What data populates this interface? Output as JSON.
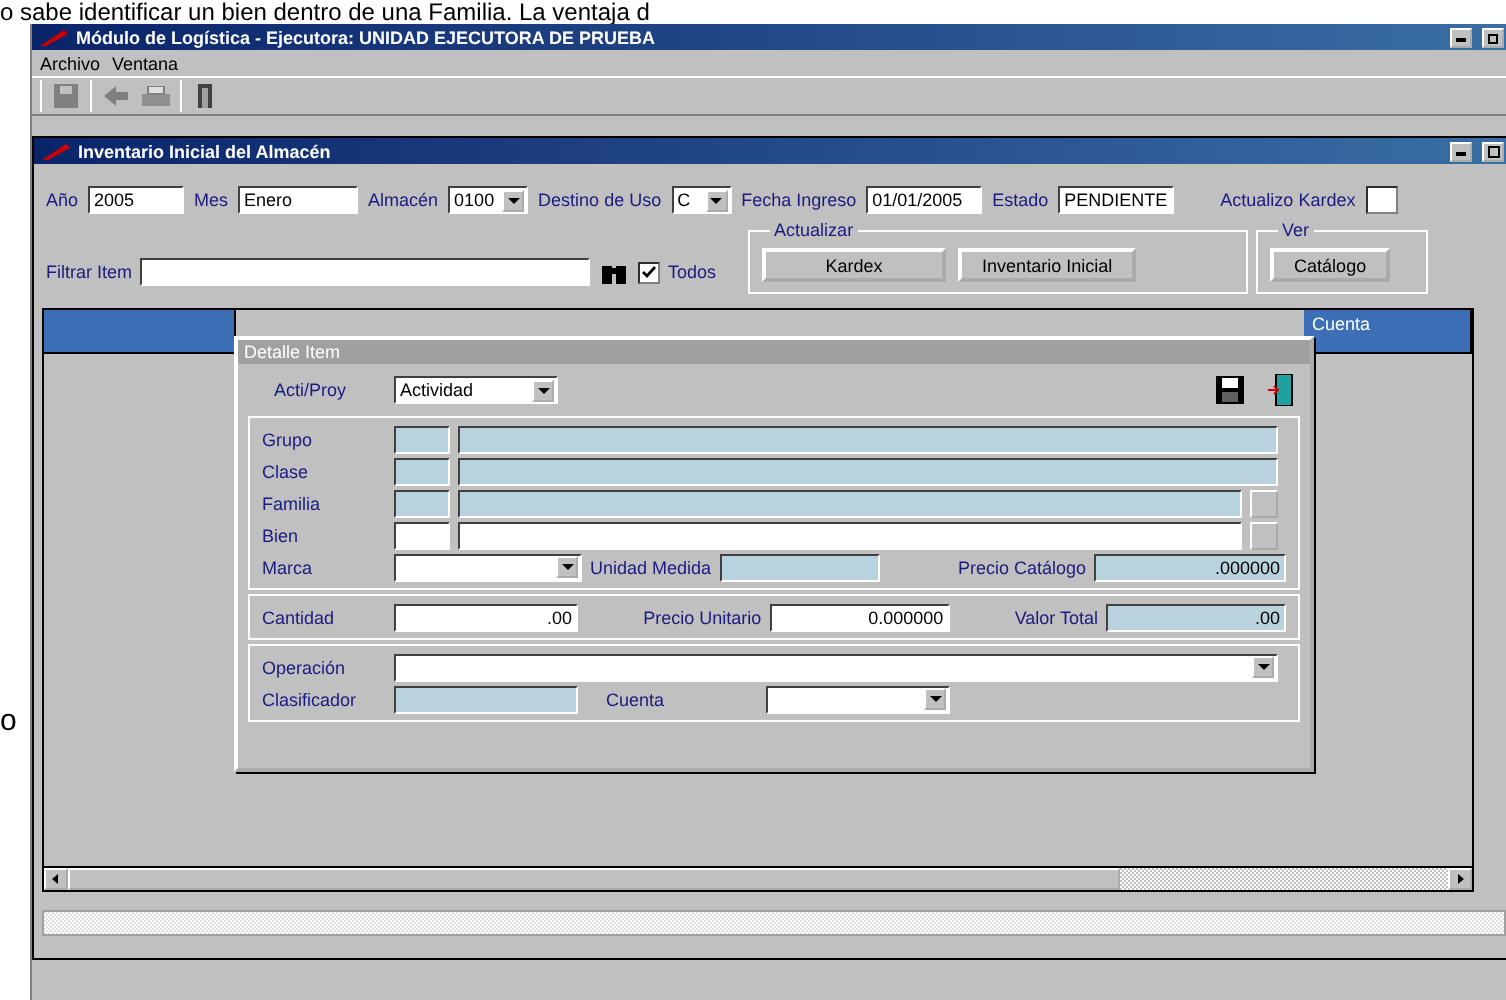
{
  "document_text": {
    "top_line": "o sabe identificar un bien dentro de una Familia.  La ventaja d",
    "left_fragment": "o"
  },
  "app_window": {
    "title": "Módulo de Logística - Ejecutora: UNIDAD EJECUTORA DE PRUEBA",
    "menu": [
      "Archivo",
      "Ventana"
    ]
  },
  "child_window": {
    "title": "Inventario Inicial del Almacén",
    "header_fields": [
      {
        "label": "Año",
        "value": "2005",
        "kind": "text"
      },
      {
        "label": "Mes",
        "value": "Enero",
        "kind": "text"
      },
      {
        "label": "Almacén",
        "value": "0100",
        "kind": "combo"
      },
      {
        "label": "Destino de Uso",
        "value": "C",
        "kind": "combo"
      },
      {
        "label": "Fecha Ingreso",
        "value": "01/01/2005",
        "kind": "text"
      },
      {
        "label": "Estado",
        "value": "PENDIENTE",
        "kind": "text"
      }
    ],
    "kardex_checkbox": {
      "label": "Actualizo Kardex",
      "checked": false
    },
    "filter": {
      "label": "Filtrar Item",
      "all_checkbox": {
        "label": "Todos",
        "checked": true
      }
    },
    "groups": [
      {
        "title": "Actualizar",
        "buttons": [
          "Kardex",
          "Inventario Inicial"
        ]
      },
      {
        "title": "Ver",
        "buttons": [
          "Catálogo"
        ]
      }
    ],
    "grid": {
      "columns": [
        "Cuenta"
      ]
    }
  },
  "dialog": {
    "title": "Detalle Item",
    "acti_proy": {
      "label": "Acti/Proy",
      "value": "Actividad"
    },
    "classification_rows": [
      {
        "label": "Grupo",
        "readonly": true,
        "lookup_button": false
      },
      {
        "label": "Clase",
        "readonly": true,
        "lookup_button": false
      },
      {
        "label": "Familia",
        "readonly": true,
        "lookup_button": true
      },
      {
        "label": "Bien",
        "readonly": false,
        "lookup_button": true
      }
    ],
    "marca": {
      "label": "Marca"
    },
    "unidad_medida": {
      "label": "Unidad Medida"
    },
    "precio_catalogo": {
      "label": "Precio Catálogo",
      "value": ".000000"
    },
    "amounts": [
      {
        "label": "Cantidad",
        "value": ".00",
        "readonly": false
      },
      {
        "label": "Precio Unitario",
        "value": "0.000000",
        "readonly": false
      },
      {
        "label": "Valor Total",
        "value": ".00",
        "readonly": true
      }
    ],
    "operacion": {
      "label": "Operación"
    },
    "clasificador": {
      "label": "Clasificador"
    },
    "cuenta": {
      "label": "Cuenta"
    }
  }
}
